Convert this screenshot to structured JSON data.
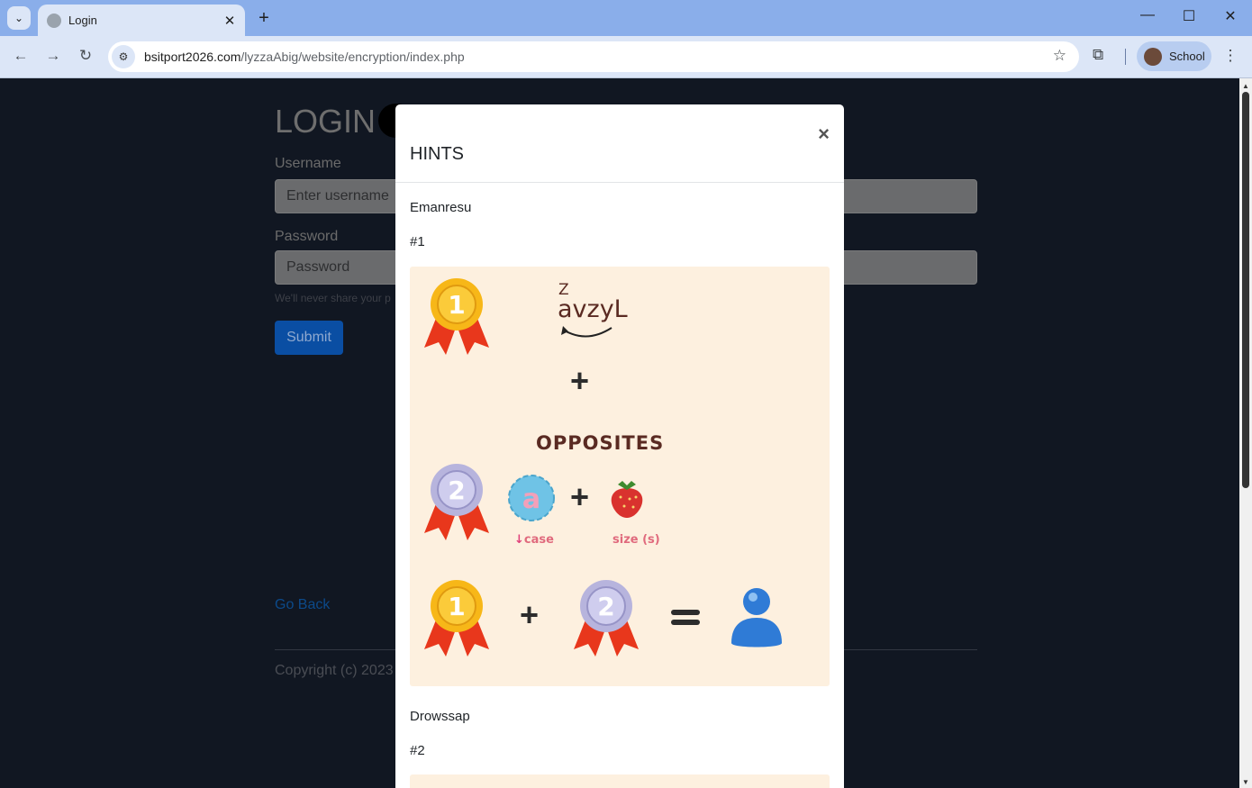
{
  "browser": {
    "tab_title": "Login",
    "url_host": "bsitport2026.com",
    "url_path": "/lyzzaAbig/website/encryption/index.php",
    "profile_label": "School"
  },
  "page": {
    "title": "LOGIN",
    "username_label": "Username",
    "username_placeholder": "Enter username",
    "password_label": "Password",
    "password_placeholder": "Password",
    "help_text": "We'll never share your p",
    "submit_label": "Submit",
    "go_back": "Go Back",
    "copyright": "Copyright (c) 2023"
  },
  "modal": {
    "title": "HINTS",
    "close": "×",
    "hint1_name": "Emanresu",
    "hint1_number": "#1",
    "hint2_name": "Drowssap",
    "hint2_number": "#2",
    "hint1_image": {
      "medal1": "1",
      "medal2": "2",
      "word_top_letter": "Z",
      "word": "avzyL",
      "opposites": "OPPOSITES",
      "bubble_letter": "a",
      "case_label": "case",
      "size_label": "size (s)"
    }
  }
}
